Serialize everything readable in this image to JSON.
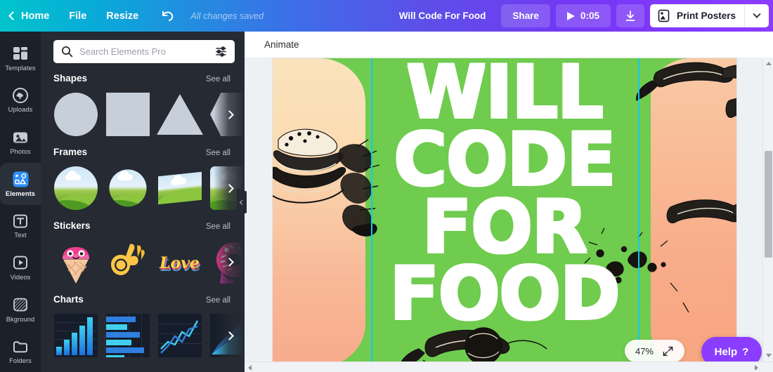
{
  "topbar": {
    "home_label": "Home",
    "file_label": "File",
    "resize_label": "Resize",
    "undo_icon": "undo-arrow-icon",
    "saved_status": "All changes saved",
    "doc_title": "Will Code For Food",
    "share_label": "Share",
    "timer_label": "0:05",
    "play_icon": "play-triangle-icon",
    "download_icon": "download-icon",
    "print_label": "Print Posters",
    "print_icon": "print-poster-icon",
    "caret_icon": "chevron-down-icon",
    "colors": {
      "gradient_start": "#00c4cc",
      "gradient_mid": "#3d6ee8",
      "gradient_end": "#8b3dff"
    }
  },
  "rail": {
    "items": [
      {
        "label": "Templates",
        "icon": "templates-grid-icon",
        "active": false
      },
      {
        "label": "Uploads",
        "icon": "cloud-upload-icon",
        "active": false
      },
      {
        "label": "Photos",
        "icon": "photo-mountain-icon",
        "active": false
      },
      {
        "label": "Elements",
        "icon": "elements-shapes-icon",
        "active": true
      },
      {
        "label": "Text",
        "icon": "text-t-icon",
        "active": false
      },
      {
        "label": "Videos",
        "icon": "video-play-icon",
        "active": false
      },
      {
        "label": "Bkground",
        "icon": "background-hatch-icon",
        "active": false
      },
      {
        "label": "Folders",
        "icon": "folder-icon",
        "active": false
      }
    ],
    "active_accent": "#2f8ffb"
  },
  "panel": {
    "search": {
      "placeholder": "Search Elements Pro",
      "value": "",
      "search_icon": "search-magnifier-icon",
      "filter_icon": "filter-sliders-icon"
    },
    "see_all_label": "See all",
    "next_icon": "chevron-right-icon",
    "sections": [
      {
        "title": "Shapes",
        "items": [
          "circle",
          "square",
          "triangle",
          "hexagon"
        ]
      },
      {
        "title": "Frames",
        "items": [
          "circle-frame",
          "scalloped-frame",
          "skewed-rect-frame",
          "rounded-rect-frame"
        ]
      },
      {
        "title": "Stickers",
        "items": [
          "ice-cream-cone-sticker",
          "ok-hand-sticker",
          "love-lettering-sticker",
          "donut-sticker"
        ]
      },
      {
        "title": "Charts",
        "items": [
          "column-chart",
          "horizontal-bar-chart",
          "line-chart",
          "area-chart"
        ]
      }
    ],
    "collapse_icon": "chevron-left-icon"
  },
  "stage": {
    "toolbar": {
      "animate_label": "Animate"
    },
    "zoom": {
      "value": "47%",
      "fit_icon": "expand-arrows-icon"
    },
    "help": {
      "label": "Help",
      "glyph": "?",
      "color": "#8b3dff"
    },
    "poster": {
      "lines": [
        "WILL",
        "CODE",
        "FOR",
        "FOOD"
      ],
      "bg_color": "#6fcc4e",
      "band_left_color": "#fae3bc",
      "band_right_color": "#f8ab88",
      "guide_color": "#17c8e8",
      "text_color": "#ffffff"
    },
    "scrollbars": {
      "v_up_icon": "triangle-up-icon",
      "v_down_icon": "triangle-down-icon",
      "h_left_icon": "triangle-left-icon",
      "h_right_icon": "triangle-right-icon"
    }
  }
}
